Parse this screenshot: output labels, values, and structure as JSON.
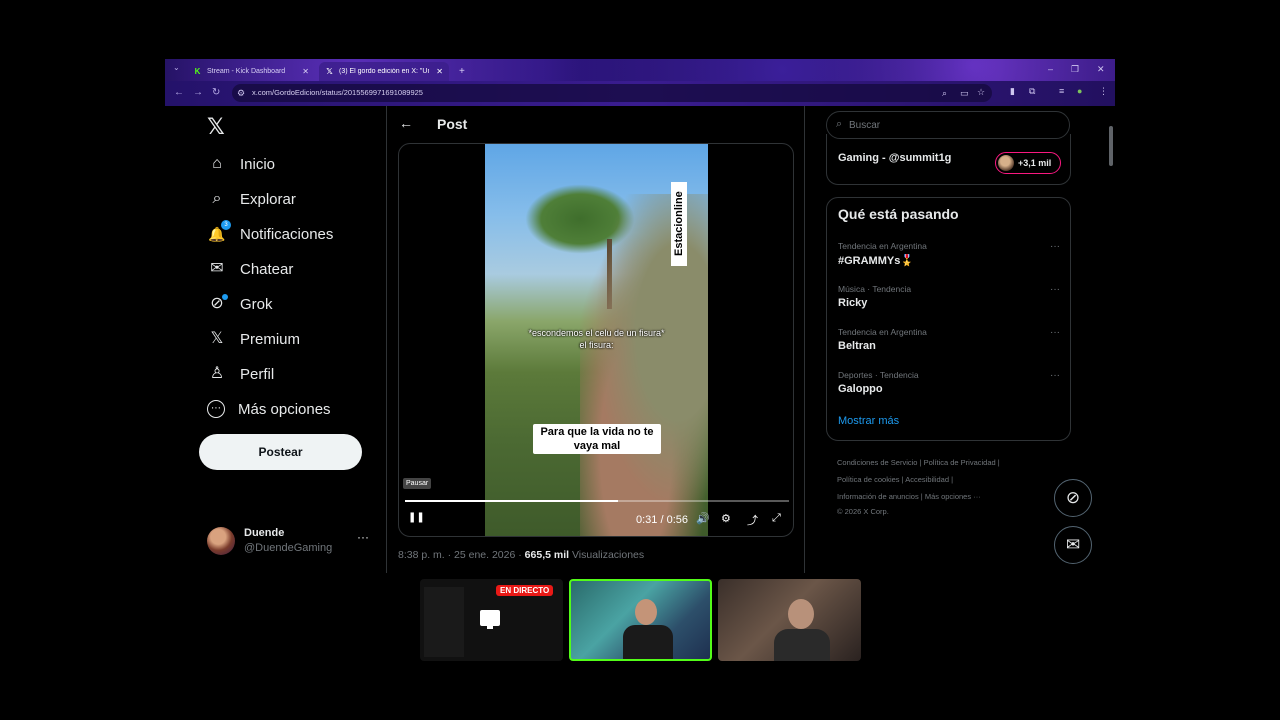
{
  "browser": {
    "tabs": [
      {
        "label": "Stream - Kick Dashboard",
        "favicon": "K"
      },
      {
        "label": "(3) El gordo edición en X: \"Un pib",
        "favicon": "𝕏"
      }
    ],
    "new_tab": "+",
    "url": "x.com/GordoEdicion/status/2015569971691089925",
    "window_controls": {
      "minimize": "–",
      "restore": "❐",
      "close": "✕"
    }
  },
  "nav": {
    "logo": "𝕏",
    "items": [
      {
        "label": "Inicio",
        "icon": "⌂"
      },
      {
        "label": "Explorar",
        "icon": "⌕"
      },
      {
        "label": "Notificaciones",
        "icon": "🔔"
      },
      {
        "label": "Chatear",
        "icon": "✉"
      },
      {
        "label": "Grok",
        "icon": "⊘"
      },
      {
        "label": "Premium",
        "icon": "𝕏"
      },
      {
        "label": "Perfil",
        "icon": "♙"
      },
      {
        "label": "Más opciones",
        "icon": "⋯"
      }
    ],
    "post_button": "Postear",
    "account": {
      "name": "Duende",
      "handle": "@DuendeGaming",
      "more": "···"
    }
  },
  "post": {
    "back": "←",
    "title": "Post",
    "video": {
      "vertical_text": "Estacionline",
      "subtitle_top": "*escondemos el celu de un fisura*\nel fisura:",
      "subtitle_bottom": "Para que la vida no te vaya mal",
      "tooltip": "Pausar",
      "time": "0:31 / 0:56",
      "progress": 0.554,
      "icons": {
        "pause": "❚❚",
        "volume": "🔊",
        "settings": "⚙",
        "rotate": "⤴",
        "fullscreen": "⤢"
      }
    },
    "meta_time": "8:38 p. m. · 25 ene. 2026 · ",
    "meta_views": "665,5 mil",
    "meta_views_label": " Visualizaciones"
  },
  "sidebar": {
    "search_placeholder": "Buscar",
    "live": {
      "name": "Gaming - @summit1g",
      "count": "+3,1 mil"
    },
    "trends_title": "Qué está pasando",
    "trends": [
      {
        "context": "Tendencia en Argentina",
        "name": "#GRAMMYs🎖️"
      },
      {
        "context": "Música · Tendencia",
        "name": "Ricky"
      },
      {
        "context": "Tendencia en Argentina",
        "name": "Beltran"
      },
      {
        "context": "Deportes · Tendencia",
        "name": "Galoppo"
      }
    ],
    "show_more": "Mostrar más",
    "footer": [
      "Condiciones de Servicio  |   Política de Privacidad  |",
      "Política de cookies  |   Accesibilidad  |",
      "Información de anuncios  |   Más opciones ···",
      "© 2026 X Corp."
    ]
  },
  "thumbs": {
    "live_badge": "EN DIRECTO"
  }
}
